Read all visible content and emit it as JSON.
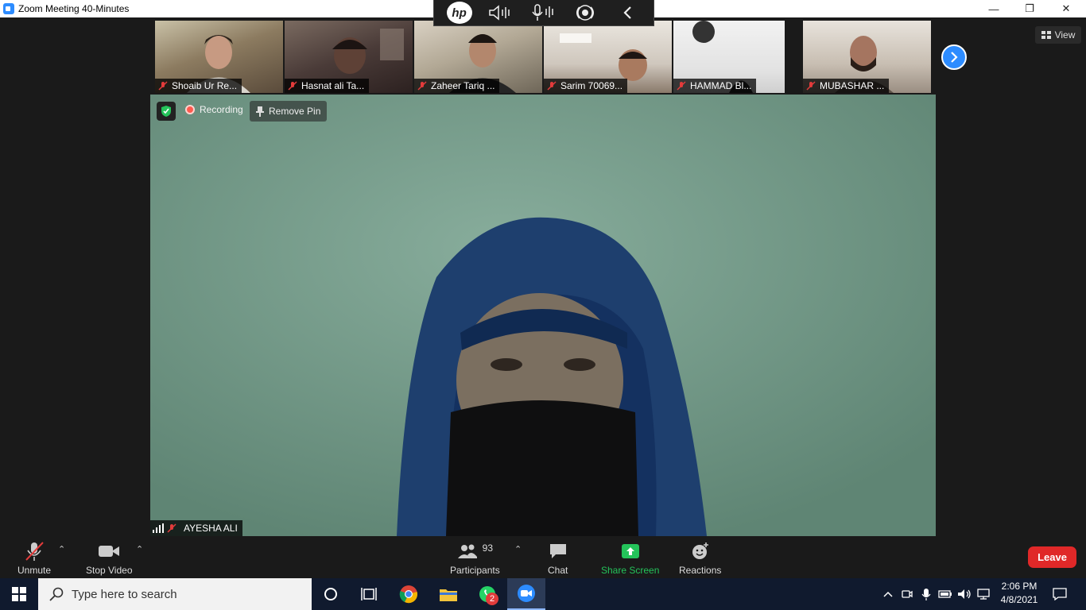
{
  "window": {
    "title": "Zoom Meeting 40-Minutes",
    "minimize": "—",
    "restore": "❐",
    "close": "✕"
  },
  "hp_toolbar": {
    "logo": "hp"
  },
  "thumbnails": [
    {
      "name": "Shoaib Ur Re..."
    },
    {
      "name": "Hasnat ali Ta..."
    },
    {
      "name": "Zaheer Tariq ..."
    },
    {
      "name": "Sarim 70069..."
    },
    {
      "name": "HAMMAD Bl..."
    },
    {
      "name": "MUBASHAR ..."
    }
  ],
  "view_button": {
    "label": "View"
  },
  "main_video": {
    "recording_label": "Recording",
    "remove_pin_label": "Remove Pin",
    "participant_name": "AYESHA ALI"
  },
  "controls": {
    "unmute": "Unmute",
    "stop_video": "Stop Video",
    "participants": "Participants",
    "participants_count": "93",
    "chat": "Chat",
    "share_screen": "Share Screen",
    "reactions": "Reactions",
    "leave": "Leave",
    "share_color": "#24c35a",
    "leave_color": "#e02828"
  },
  "taskbar": {
    "search_placeholder": "Type here to search",
    "whatsapp_badge": "2",
    "time": "2:06 PM",
    "date": "4/8/2021"
  }
}
